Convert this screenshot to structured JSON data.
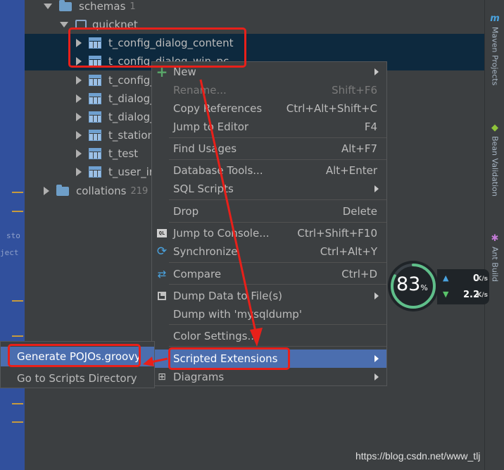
{
  "left_strip": {
    "stub_1": "sto",
    "stub_2": "ject"
  },
  "tree": {
    "schemas": {
      "label": "schemas",
      "count": "1"
    },
    "quicknet": {
      "label": "quicknet"
    },
    "tables": [
      "t_config_dialog_content",
      "t_config_dialog_win_pc",
      "t_config_",
      "t_dialog_",
      "t_dialog_",
      "t_station_",
      "t_test",
      "t_user_ir"
    ],
    "collations": {
      "label": "collations",
      "count": "219"
    }
  },
  "context_menu": {
    "new": {
      "label": "New"
    },
    "rename": {
      "label": "Rename...",
      "shortcut": "Shift+F6"
    },
    "copy_references": {
      "label": "Copy References",
      "shortcut": "Ctrl+Alt+Shift+C"
    },
    "jump_to_editor": {
      "label": "Jump to Editor",
      "shortcut": "F4"
    },
    "find_usages": {
      "label": "Find Usages",
      "shortcut": "Alt+F7"
    },
    "database_tools": {
      "label": "Database Tools...",
      "shortcut": "Alt+Enter"
    },
    "sql_scripts": {
      "label": "SQL Scripts"
    },
    "drop": {
      "label": "Drop",
      "shortcut": "Delete"
    },
    "jump_to_console": {
      "label": "Jump to Console...",
      "shortcut": "Ctrl+Shift+F10"
    },
    "synchronize": {
      "label": "Synchronize",
      "shortcut": "Ctrl+Alt+Y"
    },
    "compare": {
      "label": "Compare",
      "shortcut": "Ctrl+D"
    },
    "dump_data": {
      "label": "Dump Data to File(s)"
    },
    "dump_mysqldump": {
      "label": "Dump with 'mysqldump'"
    },
    "color_settings": {
      "label": "Color Settings..."
    },
    "scripted_extensions": {
      "label": "Scripted Extensions"
    },
    "diagrams": {
      "label": "Diagrams"
    }
  },
  "submenu": {
    "generate_pojos": "Generate POJOs.groovy",
    "go_to_scripts": "Go to Scripts Directory"
  },
  "right_toolbar": {
    "maven": {
      "icon": "m",
      "label": "Maven Projects"
    },
    "bean": {
      "label": "Bean Validation"
    },
    "ant": {
      "label": "Ant Build"
    }
  },
  "net_monitor": {
    "percent": "83",
    "percent_sign": "%",
    "up_value": "0",
    "up_unit": "K/s",
    "down_value": "2.2",
    "down_unit": "K/s"
  },
  "watermark": "https://blog.csdn.net/www_tlj",
  "colors": {
    "menu_highlight": "#4b6eaf",
    "annotation_red": "#e8201a",
    "selection": "#0d293e"
  }
}
